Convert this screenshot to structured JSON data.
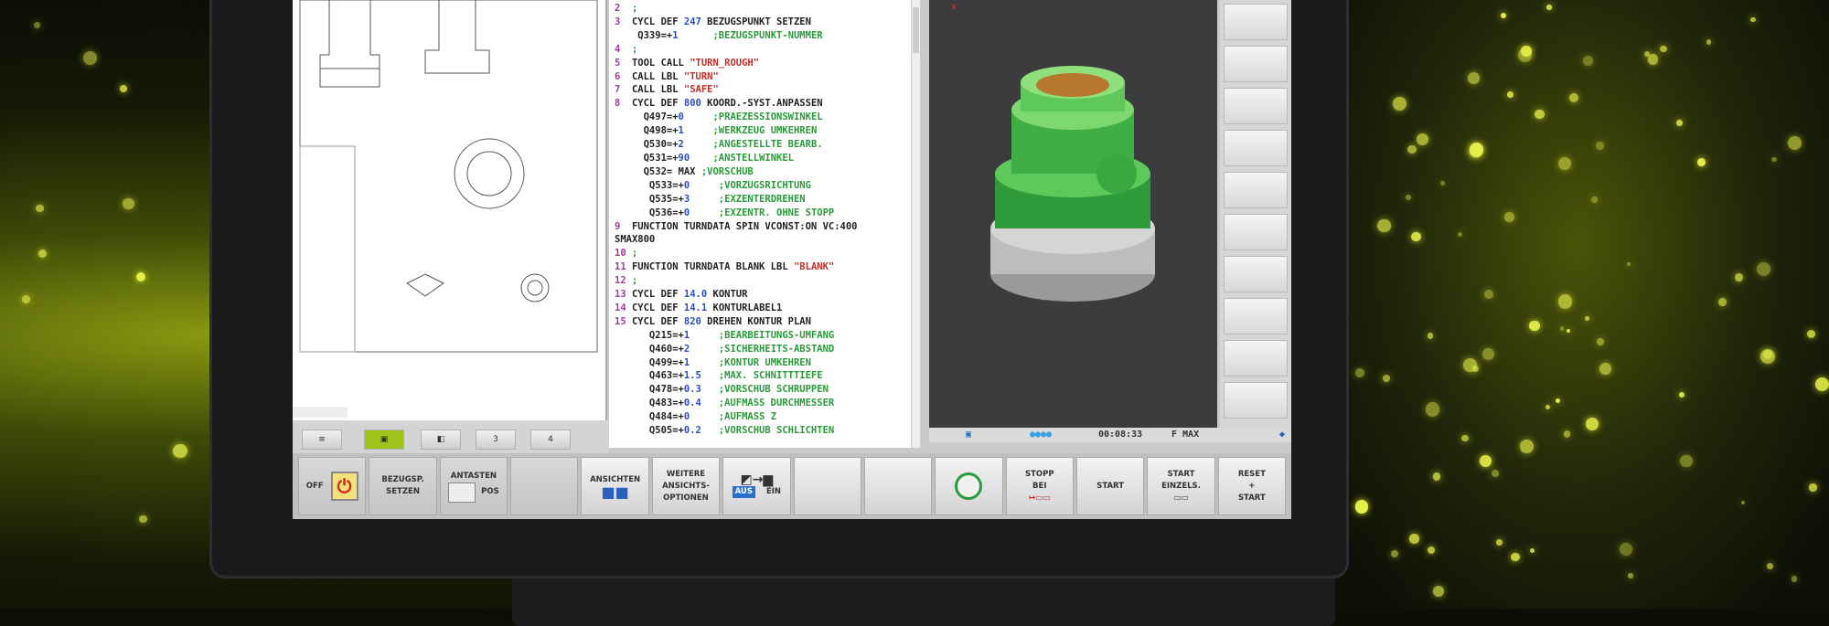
{
  "program": {
    "lines": [
      [
        [
          "ln",
          "2  "
        ],
        [
          "cm",
          ";"
        ]
      ],
      [
        [
          "ln",
          "3  "
        ],
        [
          "kw",
          "CYCL DEF "
        ],
        [
          "num",
          "247"
        ],
        [
          "kw",
          " BEZUGSPUNKT SETZEN"
        ]
      ],
      [
        [
          "kw",
          "    Q339=+"
        ],
        [
          "num",
          "1"
        ],
        [
          "cm",
          "      ;BEZUGSPUNKT-NUMMER"
        ]
      ],
      [
        [
          "ln",
          "4  "
        ],
        [
          "cm",
          ";"
        ]
      ],
      [
        [
          "ln",
          "5  "
        ],
        [
          "kw",
          "TOOL CALL "
        ],
        [
          "str",
          "\"TURN_ROUGH\""
        ]
      ],
      [
        [
          "ln",
          "6  "
        ],
        [
          "kw",
          "CALL LBL "
        ],
        [
          "str",
          "\"TURN\""
        ]
      ],
      [
        [
          "ln",
          "7  "
        ],
        [
          "kw",
          "CALL LBL "
        ],
        [
          "str",
          "\"SAFE\""
        ]
      ],
      [
        [
          "ln",
          "8  "
        ],
        [
          "kw",
          "CYCL DEF "
        ],
        [
          "num",
          "800"
        ],
        [
          "kw",
          " KOORD.-SYST.ANPASSEN"
        ]
      ],
      [
        [
          "kw",
          "     Q497=+"
        ],
        [
          "num",
          "0"
        ],
        [
          "cm",
          "     ;PRAEZESSIONSWINKEL"
        ]
      ],
      [
        [
          "kw",
          "     Q498=+"
        ],
        [
          "num",
          "1"
        ],
        [
          "cm",
          "     ;WERKZEUG UMKEHREN"
        ]
      ],
      [
        [
          "kw",
          "     Q530=+"
        ],
        [
          "num",
          "2"
        ],
        [
          "cm",
          "     ;ANGESTELLTE BEARB."
        ]
      ],
      [
        [
          "kw",
          "     Q531=+"
        ],
        [
          "num",
          "90"
        ],
        [
          "cm",
          "    ;ANSTELLWINKEL"
        ]
      ],
      [
        [
          "kw",
          "     Q532= MAX "
        ],
        [
          "cm",
          ";VORSCHUB"
        ]
      ],
      [
        [
          "kw",
          "      Q533=+"
        ],
        [
          "num",
          "0"
        ],
        [
          "cm",
          "     ;VORZUGSRICHTUNG"
        ]
      ],
      [
        [
          "kw",
          "      Q535=+"
        ],
        [
          "num",
          "3"
        ],
        [
          "cm",
          "     ;EXZENTERDREHEN"
        ]
      ],
      [
        [
          "kw",
          "      Q536=+"
        ],
        [
          "num",
          "0"
        ],
        [
          "cm",
          "     ;EXZENTR. OHNE STOPP"
        ]
      ],
      [
        [
          "ln",
          "9  "
        ],
        [
          "kw",
          "FUNCTION TURNDATA SPIN VCONST:ON VC:400"
        ]
      ],
      [
        [
          "kw",
          "SMAX800"
        ]
      ],
      [
        [
          "ln",
          "10 "
        ],
        [
          "cm",
          ";"
        ]
      ],
      [
        [
          "ln",
          "11 "
        ],
        [
          "kw",
          "FUNCTION TURNDATA BLANK LBL "
        ],
        [
          "str",
          "\"BLANK\""
        ]
      ],
      [
        [
          "ln",
          "12 "
        ],
        [
          "cm",
          ";"
        ]
      ],
      [
        [
          "ln",
          "13 "
        ],
        [
          "kw",
          "CYCL DEF "
        ],
        [
          "num",
          "14.0"
        ],
        [
          "kw",
          " KONTUR"
        ]
      ],
      [
        [
          "ln",
          "14 "
        ],
        [
          "kw",
          "CYCL DEF "
        ],
        [
          "num",
          "14.1"
        ],
        [
          "kw",
          " KONTURLABEL1"
        ]
      ],
      [
        [
          "ln",
          "15 "
        ],
        [
          "kw",
          "CYCL DEF "
        ],
        [
          "num",
          "820"
        ],
        [
          "kw",
          " DREHEN KONTUR PLAN"
        ]
      ],
      [
        [
          "kw",
          "      Q215=+"
        ],
        [
          "num",
          "1"
        ],
        [
          "cm",
          "     ;BEARBEITUNGS-UMFANG"
        ]
      ],
      [
        [
          "kw",
          "      Q460=+"
        ],
        [
          "num",
          "2"
        ],
        [
          "cm",
          "     ;SICHERHEITS-ABSTAND"
        ]
      ],
      [
        [
          "kw",
          "      Q499=+"
        ],
        [
          "num",
          "1"
        ],
        [
          "cm",
          "     ;KONTUR UMKEHREN"
        ]
      ],
      [
        [
          "kw",
          "      Q463=+"
        ],
        [
          "num",
          "1.5"
        ],
        [
          "cm",
          "   ;MAX. SCHNITTTIEFE"
        ]
      ],
      [
        [
          "kw",
          "      Q478=+"
        ],
        [
          "num",
          "0.3"
        ],
        [
          "cm",
          "   ;VORSCHUB SCHRUPPEN"
        ]
      ],
      [
        [
          "kw",
          "      Q483=+"
        ],
        [
          "num",
          "0.4"
        ],
        [
          "cm",
          "   ;AUFMASS DURCHMESSER"
        ]
      ],
      [
        [
          "kw",
          "      Q484=+"
        ],
        [
          "num",
          "0"
        ],
        [
          "cm",
          "     ;AUFMASS Z"
        ]
      ],
      [
        [
          "kw",
          "      Q505=+"
        ],
        [
          "num",
          "0.2"
        ],
        [
          "cm",
          "   ;VORSCHUB SCHLICHTEN"
        ]
      ]
    ]
  },
  "status": {
    "time": "00:08:33",
    "feed": "F MAX"
  },
  "left_toolbar": {
    "btn3": "3",
    "btn4": "4"
  },
  "softkeys": {
    "off": "OFF",
    "bezugsp_1": "BEZUGSP.",
    "bezugsp_2": "SETZEN",
    "antasten": "ANTASTEN",
    "pos": "POS",
    "ansichten": "ANSICHTEN",
    "weitere_1": "WEITERE",
    "weitere_2": "ANSICHTS-",
    "weitere_3": "OPTIONEN",
    "aus": "AUS",
    "ein": "EIN",
    "stopp_1": "STOPP",
    "stopp_2": "BEI",
    "start": "START",
    "start_einzels_1": "START",
    "start_einzels_2": "EINZELS.",
    "reset_1": "RESET",
    "reset_2": "+",
    "reset_3": "START"
  },
  "colors": {
    "accent_green": "#9cc41a",
    "background": "#0d1005"
  }
}
